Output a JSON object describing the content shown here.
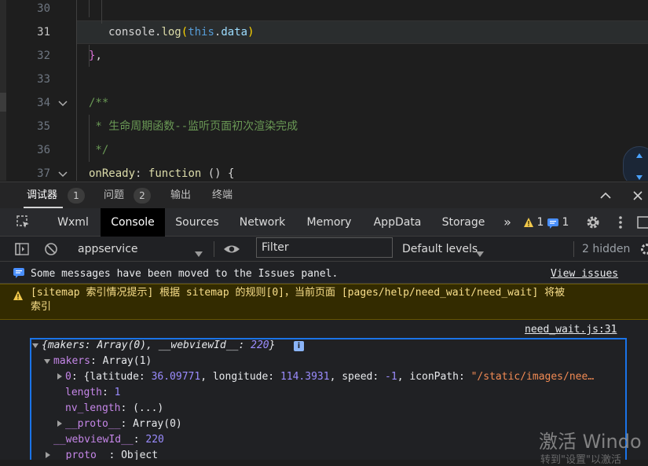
{
  "editor": {
    "lines": [
      {
        "num": "30",
        "text": ""
      },
      {
        "num": "31",
        "text": "console.log(this.data)"
      },
      {
        "num": "32",
        "text": "},"
      },
      {
        "num": "33",
        "text": ""
      },
      {
        "num": "34",
        "text": "/**"
      },
      {
        "num": "35",
        "text": " * 生命周期函数--监听页面初次渲染完成"
      },
      {
        "num": "36",
        "text": " */"
      },
      {
        "num": "37",
        "text": "onReady: function () {"
      }
    ],
    "tokens": {
      "console": "console",
      "dot1": ".",
      "log": "log",
      "paren_open": "(",
      "this": "this",
      "dot2": ".",
      "data": "data",
      "paren_close": ")",
      "brace": "}",
      "comma": ",",
      "onready": "onReady",
      "colon": ":",
      "function": "function",
      "fn_rest": " () {"
    }
  },
  "panel_tabs": [
    {
      "label": "调试器",
      "badge": "1"
    },
    {
      "label": "问题",
      "badge": "2"
    },
    {
      "label": "输出"
    },
    {
      "label": "终端"
    }
  ],
  "devtools_tabs": [
    "Wxml",
    "Console",
    "Sources",
    "Network",
    "Memory",
    "AppData",
    "Storage"
  ],
  "devtools_active_tab": "Console",
  "more_tabs_glyph": "»",
  "warning_count": "1",
  "info_count": "1",
  "toolbar": {
    "context": "appservice",
    "filter_placeholder": "Filter",
    "levels": "Default levels",
    "hidden": "2 hidden"
  },
  "messages": {
    "issues_moved": "Some messages have been moved to the Issues panel.",
    "view_issues": "View issues",
    "sitemap_warning_line1": "[sitemap 索引情况提示] 根据 sitemap 的规则[0]，当前页面 [pages/help/need_wait/need_wait] 将被",
    "sitemap_warning_line2": "索引",
    "source_link": "need_wait.js:31",
    "info_badge": "i"
  },
  "object_tree": {
    "root_open": "{",
    "root_makers_key": "makers",
    "root_makers_val": "Array(0)",
    "root_sep": ", ",
    "root_webview_key": "__webviewId__",
    "root_webview_val": "220",
    "root_close": "}",
    "makers_key": "makers",
    "makers_val": "Array(1)",
    "item0_key": "0",
    "item0_open": "{latitude: ",
    "item0_lat": "36.09771",
    "item0_lon_key": ", longitude: ",
    "item0_lon": "114.3931",
    "item0_speed_key": ", speed: ",
    "item0_speed": "-1",
    "item0_icon_key": ", iconPath: ",
    "item0_icon": "\"/static/images/nee…",
    "length_key": "length",
    "length_val": "1",
    "nvlength_key": "nv_length",
    "nvlength_val": "(...)",
    "proto1_key": "__proto__",
    "proto1_val": "Array(0)",
    "webview_key": "__webviewId__",
    "webview_val": "220",
    "proto2_key": "__proto__",
    "proto2_val": "Object",
    "colon": ": "
  },
  "watermark": {
    "line1": "激活 Windo",
    "line2": "转到\"设置\"以激活"
  },
  "colors": {
    "keyword_yellow": "#dcdcaa",
    "comment_green": "#6a9955",
    "property_orange": "#ce9178",
    "this_blue": "#569cd6",
    "warning_bg": "#332b00",
    "warning_text": "#f9df8b",
    "tree_border": "#1a73e8"
  }
}
